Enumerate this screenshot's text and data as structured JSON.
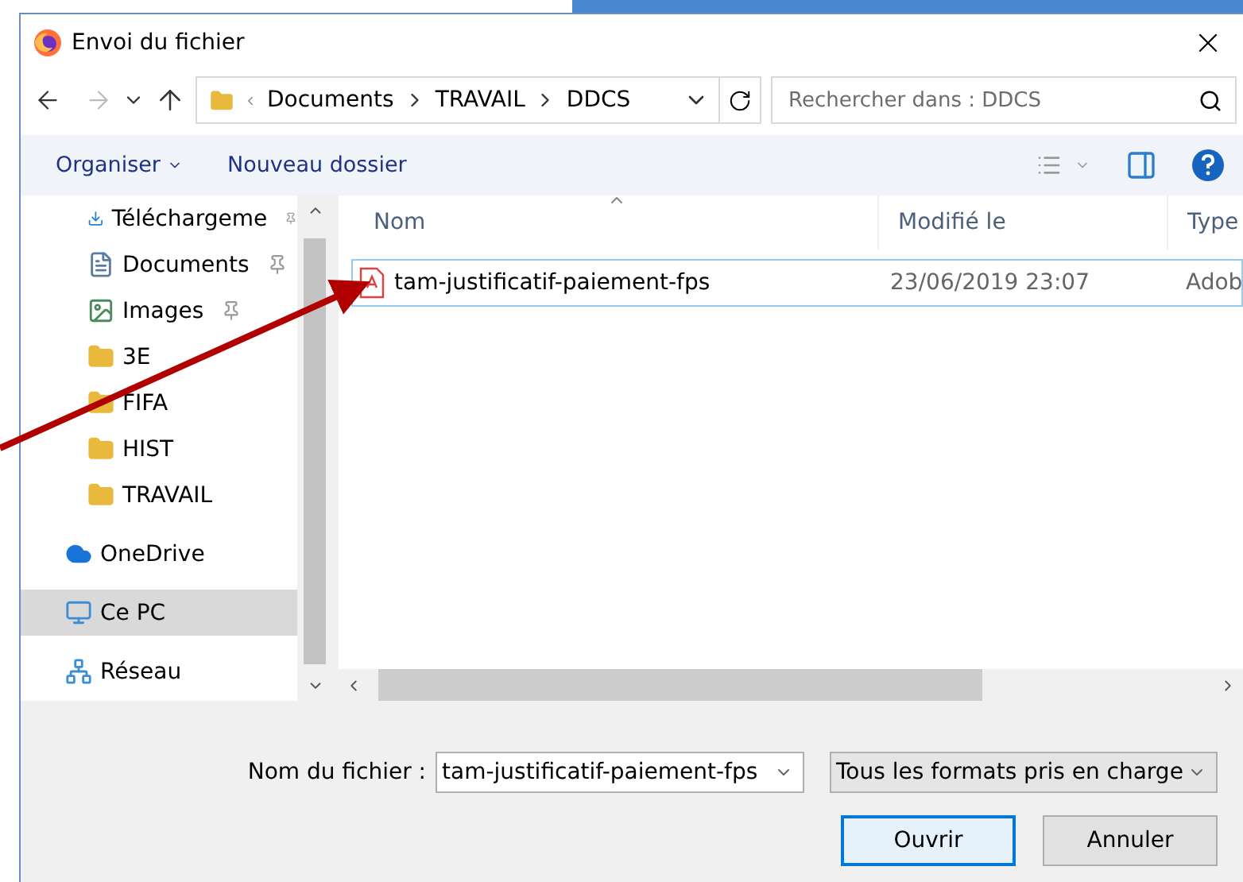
{
  "window": {
    "title": "Envoi du fichier"
  },
  "address": {
    "crumbs": [
      "Documents",
      "TRAVAIL",
      "DDCS"
    ]
  },
  "search": {
    "placeholder": "Rechercher dans : DDCS"
  },
  "toolbar": {
    "organize": "Organiser",
    "new_folder": "Nouveau dossier"
  },
  "sidebar": {
    "items": [
      {
        "label": "Téléchargeme",
        "kind": "download",
        "pinned": true,
        "selected": false
      },
      {
        "label": "Documents",
        "kind": "documents",
        "pinned": true,
        "selected": false
      },
      {
        "label": "Images",
        "kind": "images",
        "pinned": true,
        "selected": false
      },
      {
        "label": "3E",
        "kind": "folder",
        "pinned": false,
        "selected": false
      },
      {
        "label": "FIFA",
        "kind": "folder",
        "pinned": false,
        "selected": false
      },
      {
        "label": "HIST",
        "kind": "folder",
        "pinned": false,
        "selected": false
      },
      {
        "label": "TRAVAIL",
        "kind": "folder",
        "pinned": false,
        "selected": false
      },
      {
        "label": "OneDrive",
        "kind": "cloud",
        "pinned": false,
        "selected": false
      },
      {
        "label": "Ce PC",
        "kind": "pc",
        "pinned": false,
        "selected": true
      },
      {
        "label": "Réseau",
        "kind": "network",
        "pinned": false,
        "selected": false
      }
    ]
  },
  "table": {
    "columns": [
      {
        "label": "Nom",
        "sorted": true
      },
      {
        "label": "Modifié le",
        "sorted": false
      },
      {
        "label": "Type",
        "sorted": false
      }
    ],
    "rows": [
      {
        "name": "tam-justificatif-paiement-fps",
        "modified": "23/06/2019 23:07",
        "type": "Adob",
        "selected": true
      }
    ]
  },
  "footer": {
    "filename_label": "Nom du fichier :",
    "filename": "tam-justificatif-paiement-fps",
    "filter": "Tous les formats pris en charge",
    "buttons": [
      {
        "label": "Ouvrir",
        "default": true
      },
      {
        "label": "Annuler",
        "default": false
      }
    ]
  }
}
